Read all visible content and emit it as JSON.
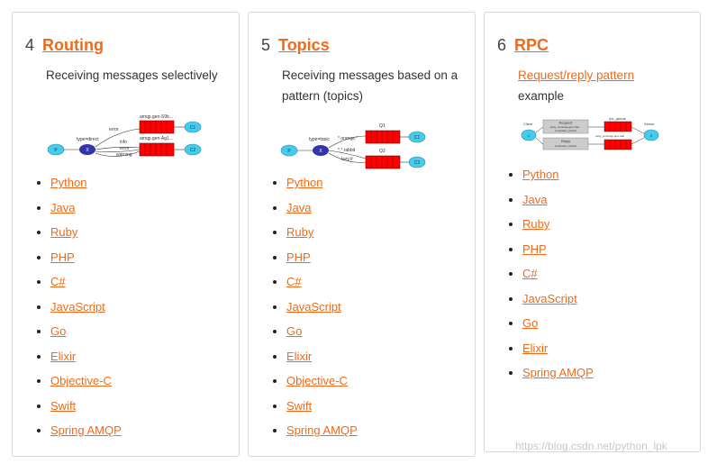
{
  "cards": [
    {
      "number": "4",
      "title": "Routing",
      "description": "Receiving messages selectively",
      "diagram_labels": [
        "amqp.gen-S9b...",
        "error",
        "type=direct",
        "info",
        "error",
        "warning",
        "amqp.gen-Ag1...",
        "X",
        "P",
        "C1",
        "C2"
      ],
      "languages": [
        "Python",
        "Java",
        "Ruby",
        "PHP",
        "C#",
        "JavaScript",
        "Go",
        "Elixir",
        "Objective-C",
        "Swift",
        "Spring AMQP"
      ]
    },
    {
      "number": "5",
      "title": "Topics",
      "description": "Receiving messages based on a pattern (topics)",
      "diagram_labels": [
        "Q1",
        "type=topic",
        "*.orange.*",
        "*.*.rabbit",
        "lazy.#",
        "Q2",
        "X",
        "P",
        "C1",
        "C2"
      ],
      "languages": [
        "Python",
        "Java",
        "Ruby",
        "PHP",
        "C#",
        "JavaScript",
        "Go",
        "Elixir",
        "Objective-C",
        "Swift",
        "Spring AMQP"
      ]
    },
    {
      "number": "6",
      "title": "RPC",
      "description_link": "Request/reply pattern",
      "description_rest": "example",
      "diagram_labels": [
        "Client",
        "Request",
        "reply_to=amqp.gen-Xa2...",
        "correlation_id=abc",
        "rpc_queue",
        "Server",
        "Reply",
        "correlation_id=abc",
        "reply_to=amqp.gen-Xa2",
        "C",
        "S"
      ],
      "languages": [
        "Python",
        "Java",
        "Ruby",
        "PHP",
        "C#",
        "JavaScript",
        "Go",
        "Elixir",
        "Spring AMQP"
      ]
    }
  ],
  "watermark": "https://blog.csdn.net/python_lpk",
  "colors": {
    "accent": "#f06a1a",
    "queue": "#ff0000",
    "consumer": "#44ccee",
    "exchange": "#3333aa"
  }
}
